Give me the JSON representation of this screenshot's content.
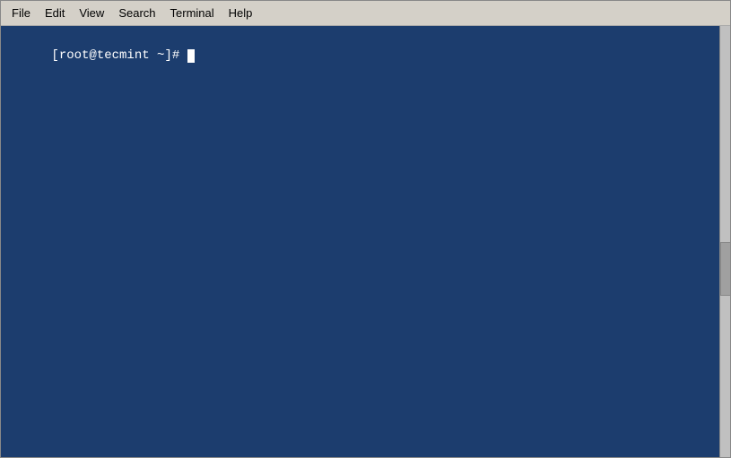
{
  "menubar": {
    "items": [
      {
        "id": "file",
        "label": "File"
      },
      {
        "id": "edit",
        "label": "Edit"
      },
      {
        "id": "view",
        "label": "View"
      },
      {
        "id": "search",
        "label": "Search"
      },
      {
        "id": "terminal",
        "label": "Terminal"
      },
      {
        "id": "help",
        "label": "Help"
      }
    ]
  },
  "terminal": {
    "prompt": "[root@tecmint ~]# "
  }
}
